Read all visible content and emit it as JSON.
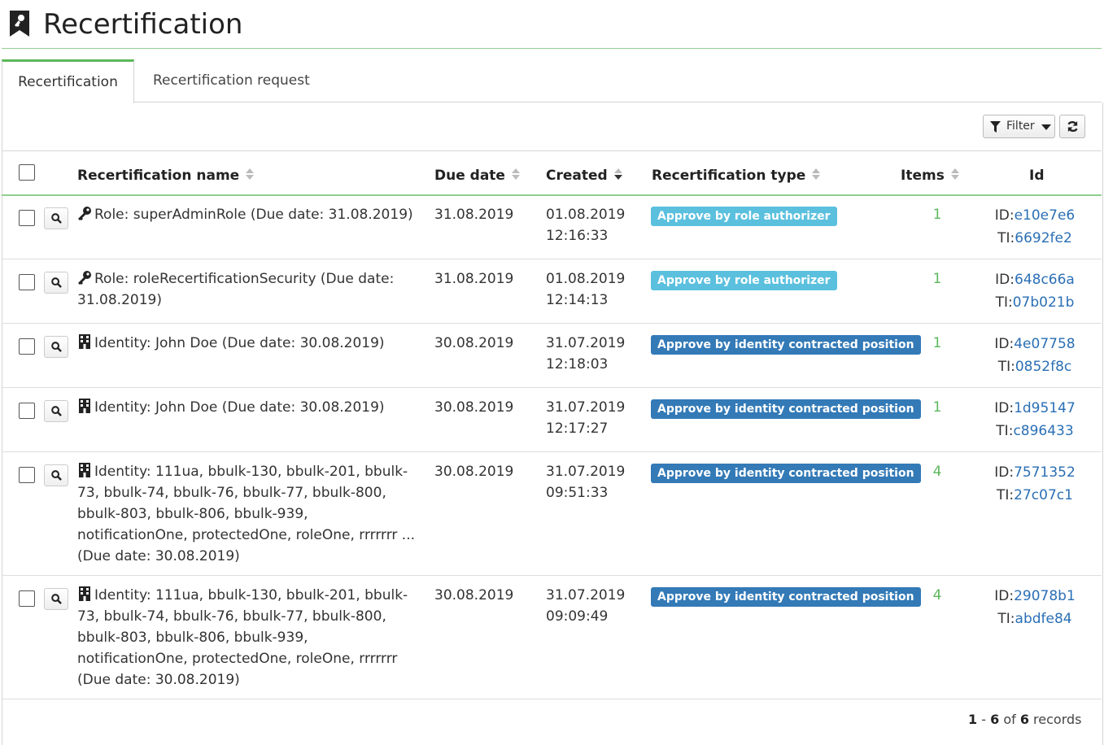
{
  "header": {
    "title": "Recertification"
  },
  "tabs": [
    {
      "label": "Recertification"
    },
    {
      "label": "Recertification request"
    }
  ],
  "toolbar": {
    "filter_label": "Filter"
  },
  "columns": {
    "name": "Recertification name",
    "due": "Due date",
    "created": "Created",
    "type": "Recertification type",
    "items": "Items",
    "id": "Id"
  },
  "colors": {
    "role_badge": "#5bc0de",
    "identity_badge": "#337ab7",
    "accent": "#5cb85c",
    "link": "#2a6fb5"
  },
  "rows": [
    {
      "icon": "key-icon",
      "name": "Role: superAdminRole (Due date: 31.08.2019)",
      "due": "31.08.2019",
      "created_date": "01.08.2019",
      "created_time": "12:16:33",
      "type": "Approve by role authorizer",
      "items": "1",
      "id_label": "ID:",
      "id": "e10e7e6",
      "ti_label": "TI:",
      "ti": "6692fe2"
    },
    {
      "icon": "key-icon",
      "name": "Role: roleRecertificationSecurity (Due date: 31.08.2019)",
      "due": "31.08.2019",
      "created_date": "01.08.2019",
      "created_time": "12:14:13",
      "type": "Approve by role authorizer",
      "items": "1",
      "id_label": "ID:",
      "id": "648c66a",
      "ti_label": "TI:",
      "ti": "07b021b"
    },
    {
      "icon": "building-icon",
      "name": "Identity: John Doe (Due date: 30.08.2019)",
      "due": "30.08.2019",
      "created_date": "31.07.2019",
      "created_time": "12:18:03",
      "type": "Approve by identity contracted position",
      "items": "1",
      "id_label": "ID:",
      "id": "4e07758",
      "ti_label": "TI:",
      "ti": "0852f8c"
    },
    {
      "icon": "building-icon",
      "name": "Identity: John Doe (Due date: 30.08.2019)",
      "due": "30.08.2019",
      "created_date": "31.07.2019",
      "created_time": "12:17:27",
      "type": "Approve by identity contracted position",
      "items": "1",
      "id_label": "ID:",
      "id": "1d95147",
      "ti_label": "TI:",
      "ti": "c896433"
    },
    {
      "icon": "building-icon",
      "name": "Identity: 111ua, bbulk-130, bbulk-201, bbulk-73, bbulk-74, bbulk-76, bbulk-77, bbulk-800, bbulk-803, bbulk-806, bbulk-939, notificationOne, protectedOne, roleOne, rrrrrrr ... (Due date: 30.08.2019)",
      "due": "30.08.2019",
      "created_date": "31.07.2019",
      "created_time": "09:51:33",
      "type": "Approve by identity contracted position",
      "items": "4",
      "id_label": "ID:",
      "id": "7571352",
      "ti_label": "TI:",
      "ti": "27c07c1"
    },
    {
      "icon": "building-icon",
      "name": "Identity: 111ua, bbulk-130, bbulk-201, bbulk-73, bbulk-74, bbulk-76, bbulk-77, bbulk-800, bbulk-803, bbulk-806, bbulk-939, notificationOne, protectedOne, roleOne, rrrrrrr (Due date: 30.08.2019)",
      "due": "30.08.2019",
      "created_date": "31.07.2019",
      "created_time": "09:09:49",
      "type": "Approve by identity contracted position",
      "items": "4",
      "id_label": "ID:",
      "id": "29078b1",
      "ti_label": "TI:",
      "ti": "abdfe84"
    }
  ],
  "footer": {
    "from": "1",
    "sep": " - ",
    "to": "6",
    "of": " of ",
    "total": "6",
    "suffix": " records"
  }
}
